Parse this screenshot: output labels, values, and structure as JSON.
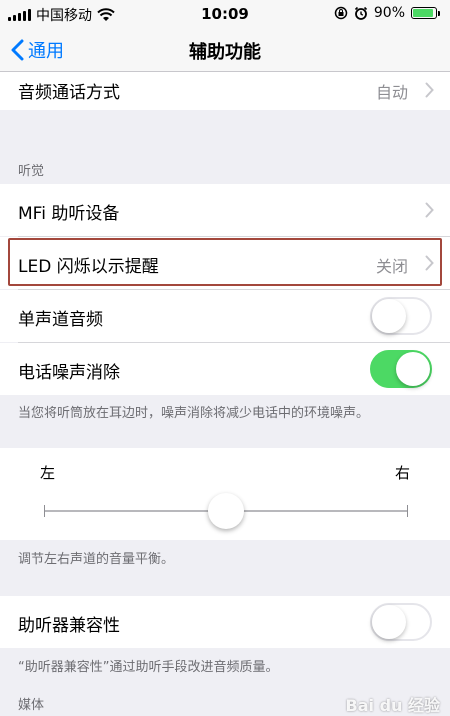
{
  "status_bar": {
    "carrier": "中国移动",
    "time": "10:09",
    "battery": "90%",
    "battery_level": 0.9,
    "battery_color": "#4cd964"
  },
  "nav": {
    "back_label": "通用",
    "title": "辅助功能",
    "accent_color": "#007aff"
  },
  "rows": {
    "audio_call": {
      "label": "音频通话方式",
      "value": "自动"
    },
    "hearing_header": "听觉",
    "mfi": {
      "label": "MFi 助听设备"
    },
    "led": {
      "label": "LED 闪烁以示提醒",
      "value": "关闭"
    },
    "mono": {
      "label": "单声道音频",
      "on": false
    },
    "noise": {
      "label": "电话噪声消除",
      "on": true
    },
    "noise_note": "当您将听筒放在耳边时，噪声消除将减少电话中的环境噪声。",
    "balance": {
      "left": "左",
      "right": "右",
      "level": 0.5
    },
    "balance_note": "调节左右声道的音量平衡。",
    "hac": {
      "label": "助听器兼容性",
      "on": false
    },
    "hac_note": "“助听器兼容性”通过助听手段改进音频质量。",
    "media_header": "媒体"
  },
  "icons": {
    "back": "chevron-left-icon",
    "disclosure": "chevron-right-icon",
    "wifi": "wifi-icon",
    "lock": "rotation-lock-icon",
    "alarm": "alarm-icon"
  },
  "watermark": "Bai du 经验"
}
